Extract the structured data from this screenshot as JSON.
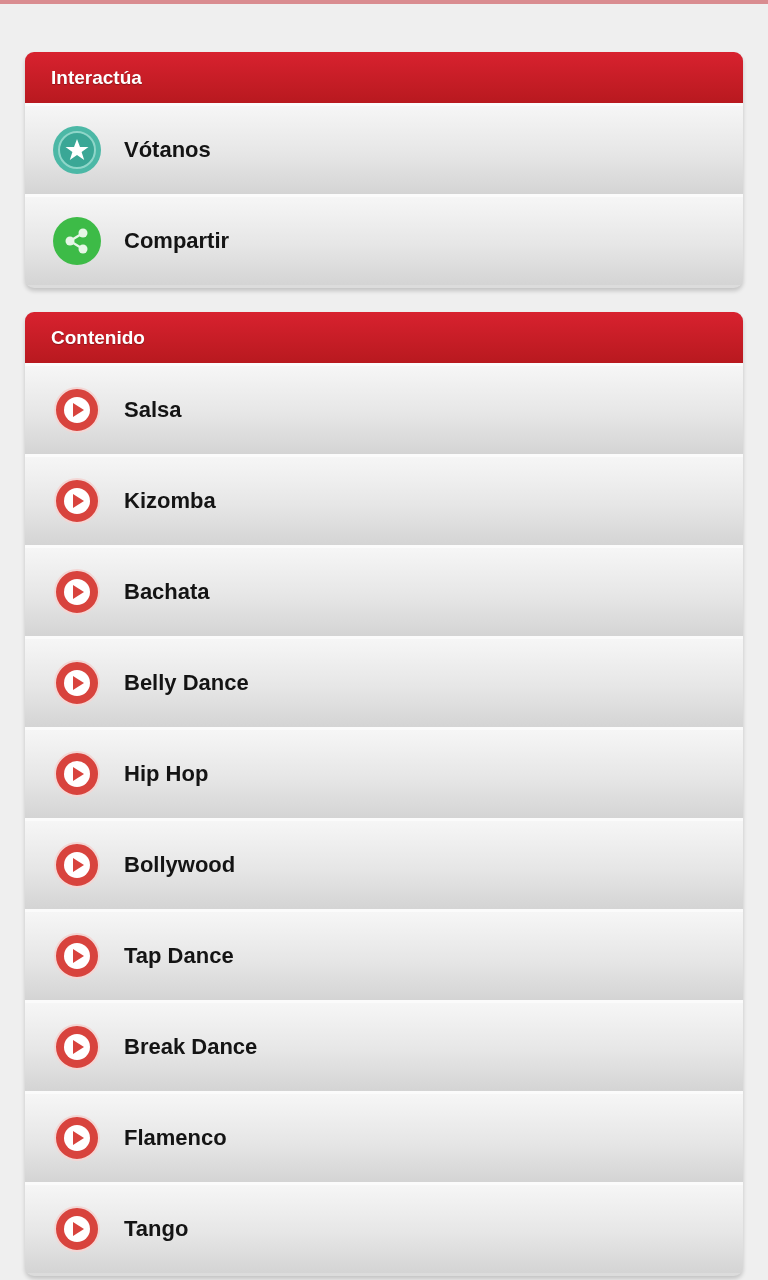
{
  "sections": [
    {
      "title": "Interactúa",
      "items": [
        {
          "kind": "star",
          "label": "Vótanos"
        },
        {
          "kind": "share",
          "label": "Compartir"
        }
      ]
    },
    {
      "title": "Contenido",
      "items": [
        {
          "kind": "play",
          "label": "Salsa"
        },
        {
          "kind": "play",
          "label": "Kizomba"
        },
        {
          "kind": "play",
          "label": "Bachata"
        },
        {
          "kind": "play",
          "label": "Belly Dance"
        },
        {
          "kind": "play",
          "label": "Hip Hop"
        },
        {
          "kind": "play",
          "label": "Bollywood"
        },
        {
          "kind": "play",
          "label": "Tap Dance"
        },
        {
          "kind": "play",
          "label": "Break Dance"
        },
        {
          "kind": "play",
          "label": "Flamenco"
        },
        {
          "kind": "play",
          "label": "Tango"
        }
      ]
    }
  ]
}
